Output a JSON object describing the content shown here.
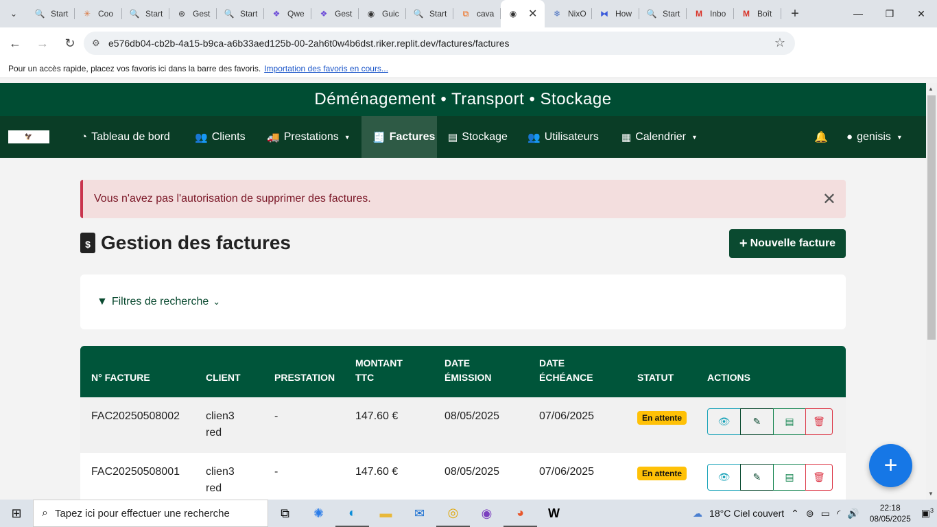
{
  "browser": {
    "tabs": [
      {
        "label": "Start",
        "icon": "search-icon"
      },
      {
        "label": "Coo",
        "icon": "claude-icon"
      },
      {
        "label": "Start",
        "icon": "search-icon"
      },
      {
        "label": "Gest",
        "icon": "openai-icon"
      },
      {
        "label": "Start",
        "icon": "search-icon"
      },
      {
        "label": "Qwe",
        "icon": "qwen-icon"
      },
      {
        "label": "Gest",
        "icon": "qwen-icon"
      },
      {
        "label": "Guic",
        "icon": "globe-icon"
      },
      {
        "label": "Start",
        "icon": "search-icon"
      },
      {
        "label": "cava",
        "icon": "replit-icon"
      },
      {
        "label": "",
        "icon": "globe-icon",
        "active": true
      },
      {
        "label": "NixO",
        "icon": "nix-icon"
      },
      {
        "label": "How",
        "icon": "chat-icon"
      },
      {
        "label": "Start",
        "icon": "search-icon"
      },
      {
        "label": "Inbo",
        "icon": "gmail-icon"
      },
      {
        "label": "Boît",
        "icon": "gmail-icon"
      }
    ],
    "url": "e576db04-cb2b-4a15-b9ca-a6b33aed125b-00-2ah6t0w4b6dst.riker.replit.dev/factures/factures",
    "bookmarks_hint": "Pour un accès rapide, placez vos favoris ici dans la barre des favoris.",
    "bookmarks_link": "Importation des favoris en cours..."
  },
  "banner": {
    "title": "Déménagement • Transport • Stockage"
  },
  "nav": {
    "items": [
      {
        "label": "Tableau de bord",
        "icon": "dashboard-icon"
      },
      {
        "label": "Clients",
        "icon": "users-icon"
      },
      {
        "label": "Prestations",
        "icon": "truck-icon",
        "dropdown": true
      },
      {
        "label": "Factures",
        "icon": "invoice-icon",
        "active": true
      },
      {
        "label": "Stockage",
        "icon": "box-icon"
      },
      {
        "label": "Utilisateurs",
        "icon": "users-icon"
      },
      {
        "label": "Calendrier",
        "icon": "calendar-icon",
        "dropdown": true
      }
    ],
    "user": "genisis"
  },
  "alert": {
    "message": "Vous n'avez pas l'autorisation de supprimer des factures."
  },
  "page": {
    "title": "Gestion des factures",
    "new_button": "Nouvelle facture",
    "filters_label": "Filtres de recherche"
  },
  "table": {
    "headers": {
      "numero": "N° FACTURE",
      "client": "CLIENT",
      "prestation": "PRESTATION",
      "montant_1": "MONTANT",
      "montant_2": "TTC",
      "emission_1": "DATE",
      "emission_2": "ÉMISSION",
      "echeance_1": "DATE",
      "echeance_2": "ÉCHÉANCE",
      "statut": "STATUT",
      "actions": "ACTIONS"
    },
    "rows": [
      {
        "numero": "FAC20250508002",
        "client_1": "clien3",
        "client_2": "red",
        "prestation": "-",
        "montant": "147.60 €",
        "emission": "08/05/2025",
        "echeance": "07/06/2025",
        "statut": "En attente"
      },
      {
        "numero": "FAC20250508001",
        "client_1": "clien3",
        "client_2": "red",
        "prestation": "-",
        "montant": "147.60 €",
        "emission": "08/05/2025",
        "echeance": "07/06/2025",
        "statut": "En attente"
      }
    ]
  },
  "taskbar": {
    "search_placeholder": "Tapez ici pour effectuer une recherche",
    "weather": "18°C  Ciel couvert",
    "time": "22:18",
    "date": "08/05/2025",
    "notifications": "3"
  }
}
